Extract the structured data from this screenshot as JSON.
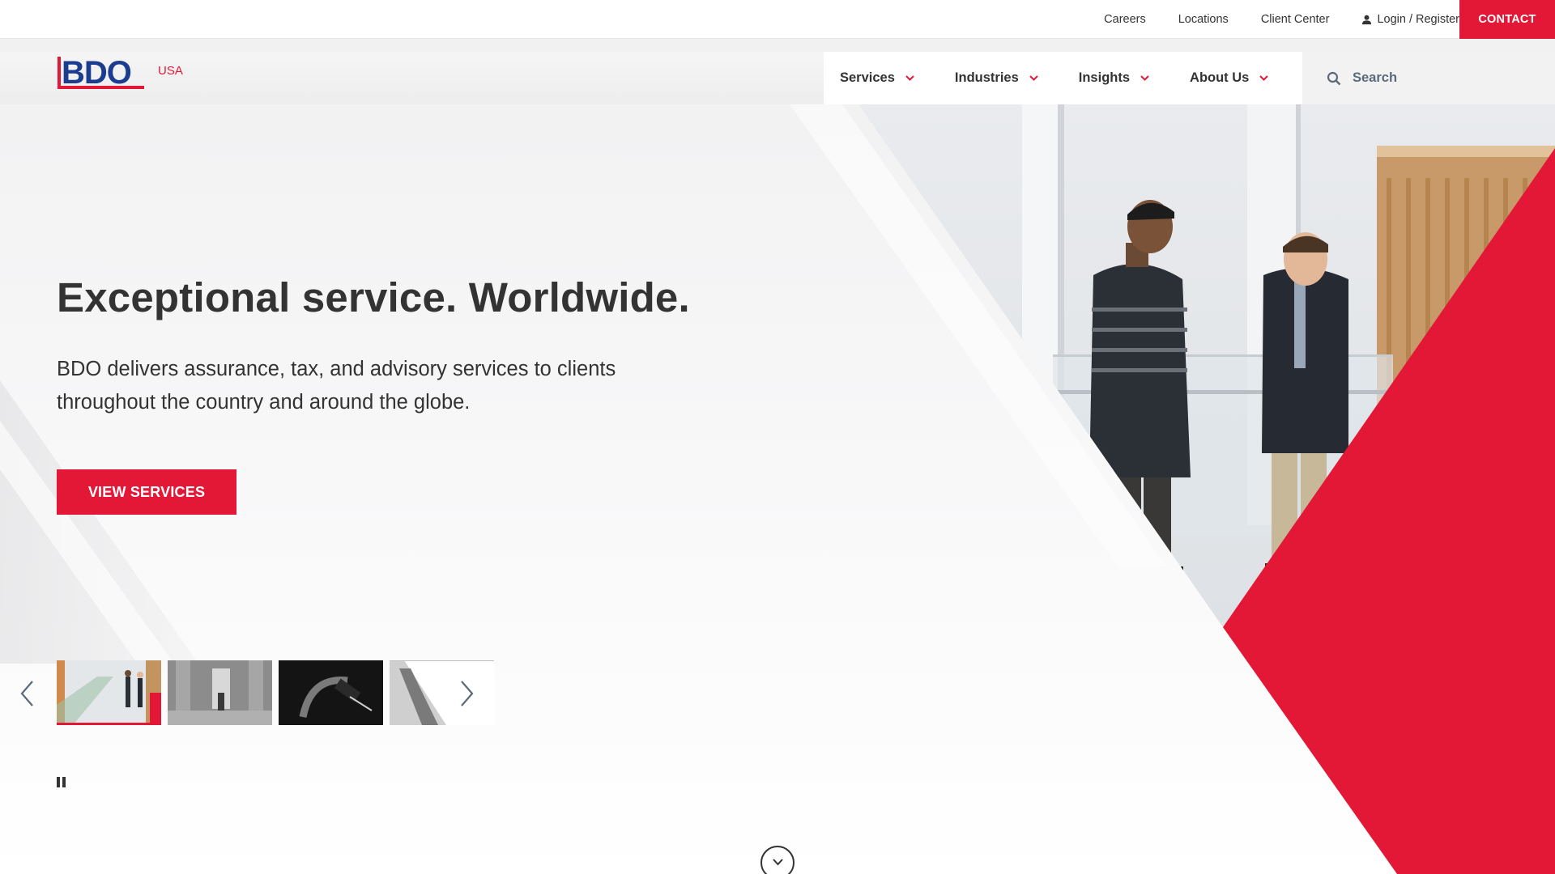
{
  "utility": {
    "links": [
      "Careers",
      "Locations",
      "Client Center"
    ],
    "login_label": "Login / Register",
    "contact_label": "CONTACT"
  },
  "header": {
    "logo_text": "BDO",
    "country": "USA",
    "nav": [
      "Services",
      "Industries",
      "Insights",
      "About Us"
    ],
    "search_placeholder": "Search"
  },
  "hero": {
    "title": "Exceptional service. Worldwide.",
    "subtitle": "BDO delivers assurance, tax, and advisory services to clients throughout the country and around the globe.",
    "cta_label": "VIEW SERVICES",
    "carousel_slide_count": 4,
    "active_slide": 1
  },
  "colors": {
    "brand_red": "#e31837",
    "brand_blue": "#1a3d8f",
    "text": "#333333"
  },
  "icons": [
    "user-icon",
    "chevron-down-icon",
    "search-icon",
    "chevron-left-icon",
    "chevron-right-icon",
    "pause-icon",
    "scroll-down-icon"
  ]
}
